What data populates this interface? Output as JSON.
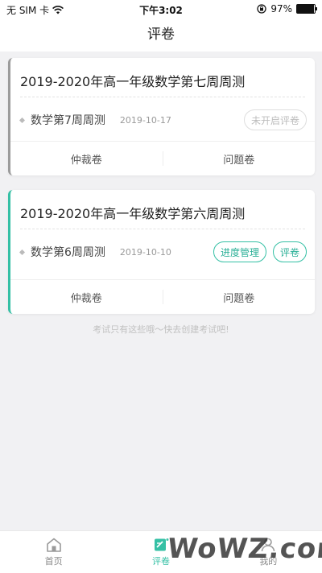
{
  "status_bar": {
    "carrier": "无 SIM 卡",
    "time": "下午3:02",
    "battery_percent": "97%",
    "battery_level": 0.97
  },
  "navbar": {
    "title": "评卷"
  },
  "exams": [
    {
      "title": "2019-2020年高一年级数学第七周周测",
      "subject": "数学第7周周测",
      "date": "2019-10-17",
      "accent": "#9b9b9b",
      "actions": [
        {
          "label": "未开启评卷",
          "state": "disabled"
        }
      ],
      "footer": {
        "left": "仲裁卷",
        "right": "问题卷"
      }
    },
    {
      "title": "2019-2020年高一年级数学第六周周测",
      "subject": "数学第6周周测",
      "date": "2019-10-10",
      "accent": "#35c0a5",
      "actions": [
        {
          "label": "进度管理",
          "state": "active"
        },
        {
          "label": "评卷",
          "state": "active"
        }
      ],
      "footer": {
        "left": "仲裁卷",
        "right": "问题卷"
      }
    }
  ],
  "empty_hint": "考试只有这些哦～快去创建考试吧!",
  "tabbar": {
    "items": [
      {
        "label": "首页",
        "icon": "home-icon",
        "active": false
      },
      {
        "label": "评卷",
        "icon": "grading-icon",
        "active": true
      },
      {
        "label": "我的",
        "icon": "user-icon",
        "active": false
      }
    ]
  },
  "watermark": {
    "text": "WoWZ.com"
  },
  "colors": {
    "accent": "#35c0a5",
    "inactive_accent": "#9b9b9b",
    "background": "#f1f1f3"
  }
}
